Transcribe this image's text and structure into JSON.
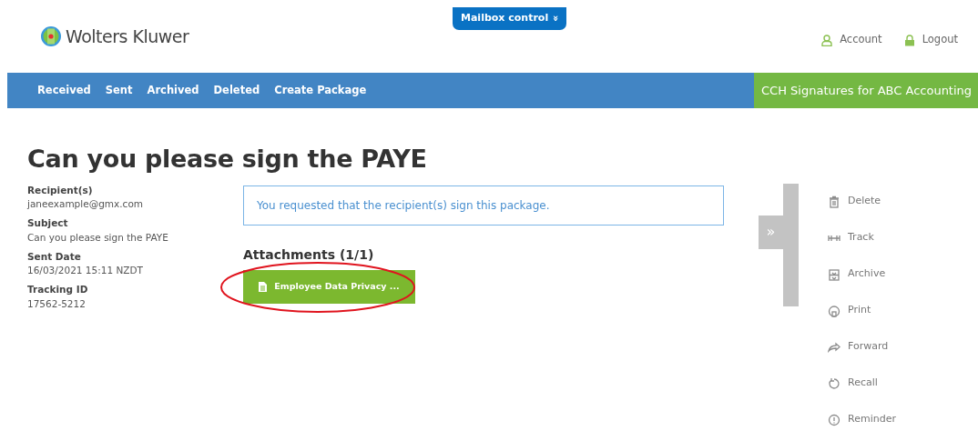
{
  "header": {
    "logo_text": "Wolters Kluwer",
    "mailbox_control": "Mailbox control",
    "mailbox_icon": "»",
    "user_links": [
      {
        "label": "Account"
      },
      {
        "label": "Logout"
      }
    ]
  },
  "nav": {
    "items": [
      {
        "label": "Received"
      },
      {
        "label": "Sent"
      },
      {
        "label": "Archived"
      },
      {
        "label": "Deleted"
      },
      {
        "label": "Create Package"
      }
    ],
    "brand": "CCH Signatures for ABC Accounting"
  },
  "title": "Can you please sign the PAYE",
  "details": [
    {
      "label": "Recipient(s)",
      "value": "janeexample@gmx.com"
    },
    {
      "label": "Subject",
      "value": "Can you please sign the PAYE"
    },
    {
      "label": "Sent Date",
      "value": "16/03/2021 15:11 NZDT"
    },
    {
      "label": "Tracking ID",
      "value": "17562-5212"
    }
  ],
  "notice": "You requested that the recipient(s) sign this package.",
  "attachments": {
    "heading": "Attachments (1/1)",
    "files": [
      {
        "label": "Employee Data Privacy ...",
        "highlighted": true
      }
    ]
  },
  "panel_toggle": "»",
  "actions": [
    {
      "label": "Delete"
    },
    {
      "label": "Track"
    },
    {
      "label": "Archive"
    },
    {
      "label": "Print"
    },
    {
      "label": "Forward"
    },
    {
      "label": "Recall"
    },
    {
      "label": "Reminder"
    }
  ]
}
